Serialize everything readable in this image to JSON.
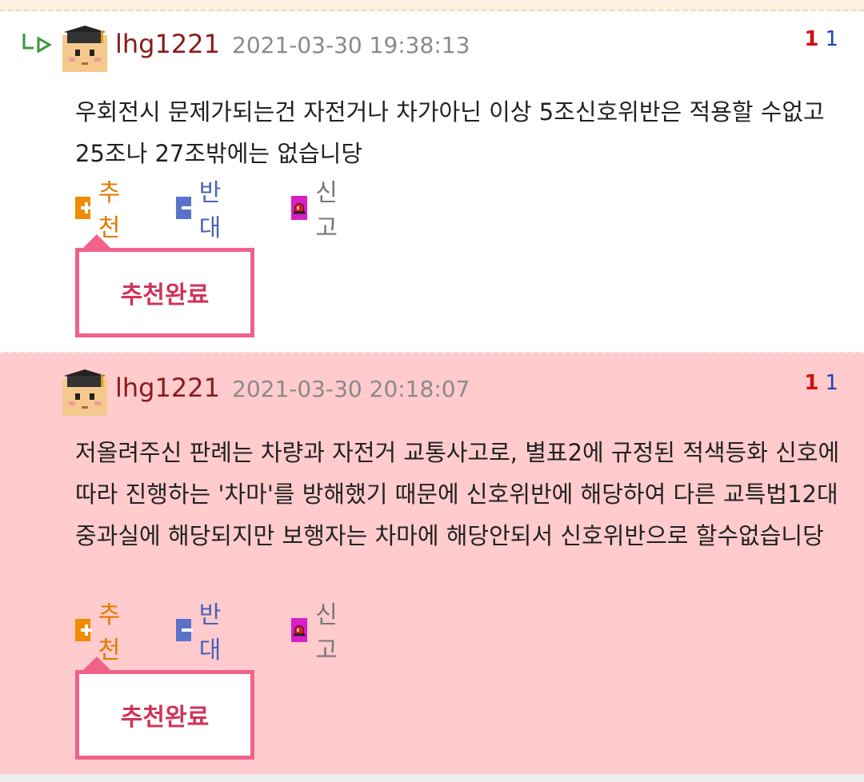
{
  "comments": [
    {
      "username": "lhg1221",
      "timestamp": "2021-03-30 19:38:13",
      "votes_up": "1",
      "votes_down": "1",
      "body": "우회전시 문제가되는건 자전거나 차가아닌 이상 5조신호위반은 적용할 수없고 25조나 27조밖에는 없습니당",
      "actions": {
        "recommend": "추천",
        "oppose": "반대",
        "report": "신고"
      },
      "tooltip": "추천완료",
      "is_reply": true,
      "highlighted": false
    },
    {
      "username": "lhg1221",
      "timestamp": "2021-03-30 20:18:07",
      "votes_up": "1",
      "votes_down": "1",
      "body": "저올려주신 판례는 차량과 자전거 교통사고로, 별표2에 규정된 적색등화 신호에 따라 진행하는 '차마'를 방해했기 때문에 신호위반에 해당하여 다른 교특법12대 중과실에 해당되지만 보행자는 차마에 해당안되서 신호위반으로 할수없습니당",
      "actions": {
        "recommend": "추천",
        "oppose": "반대",
        "report": "신고"
      },
      "tooltip": "추천완료",
      "is_reply": false,
      "highlighted": true
    }
  ],
  "colors": {
    "username": "#8b1a1a",
    "timestamp": "#8a8a8a",
    "vote_up": "#d01010",
    "vote_down": "#1f3fbf",
    "recommend": "#e07b00",
    "oppose": "#4a62b8",
    "tooltip_border": "#f0628a",
    "highlight_bg": "#ffcbcd"
  },
  "icons": {
    "reply": "reply-arrow-icon",
    "avatar": "graduate-avatar-icon",
    "recommend": "plus-icon",
    "oppose": "minus-icon",
    "report": "siren-icon"
  }
}
